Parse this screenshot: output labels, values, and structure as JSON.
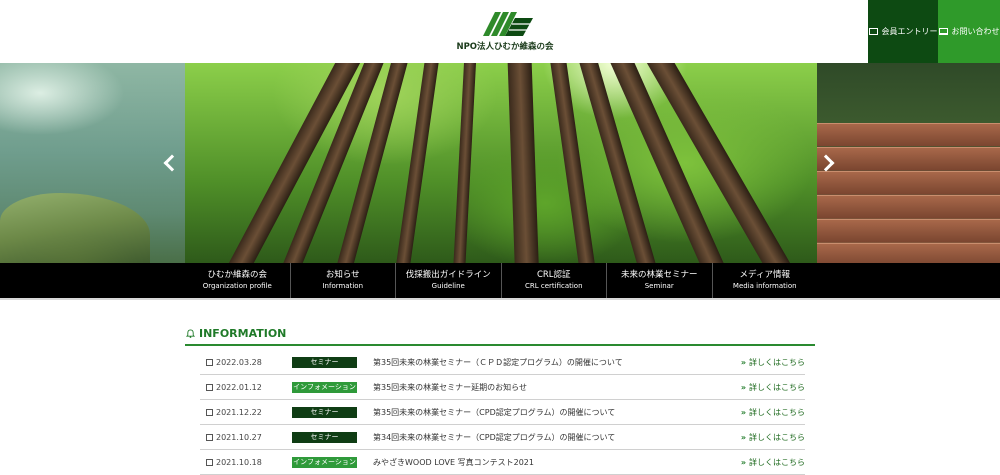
{
  "header": {
    "logo_text": "NPO法人ひむか維森の会",
    "entry_label": "会員エントリー",
    "contact_label": "お問い合わせ"
  },
  "nav": {
    "items": [
      {
        "ja": "ひむか維森の会",
        "en": "Organization profile"
      },
      {
        "ja": "お知らせ",
        "en": "Information"
      },
      {
        "ja": "伐採搬出ガイドライン",
        "en": "Guideline"
      },
      {
        "ja": "CRL認証",
        "en": "CRL certification"
      },
      {
        "ja": "未来の林業セミナー",
        "en": "Seminar"
      },
      {
        "ja": "メディア情報",
        "en": "Media information"
      }
    ]
  },
  "information": {
    "heading": "INFORMATION",
    "more_label": "詳しくはこちら",
    "rows": [
      {
        "date": "2022.03.28",
        "category": "セミナー",
        "title": "第35回未来の林業セミナー（ＣＰＤ認定プログラム）の開催について"
      },
      {
        "date": "2022.01.12",
        "category": "インフォメーション",
        "title": "第35回未来の林業セミナー延期のお知らせ"
      },
      {
        "date": "2021.12.22",
        "category": "セミナー",
        "title": "第35回未来の林業セミナー（CPD認定プログラム）の開催について"
      },
      {
        "date": "2021.10.27",
        "category": "セミナー",
        "title": "第34回未来の林業セミナー（CPD認定プログラム）の開催について"
      },
      {
        "date": "2021.10.18",
        "category": "インフォメーション",
        "title": "みやざきWOOD LOVE 写真コンテスト2021"
      }
    ]
  },
  "colors": {
    "dark_green": "#0d4a12",
    "light_green": "#2f9a2a",
    "seminar_badge": "#0f3d14",
    "info_badge": "#2f9a3a"
  }
}
